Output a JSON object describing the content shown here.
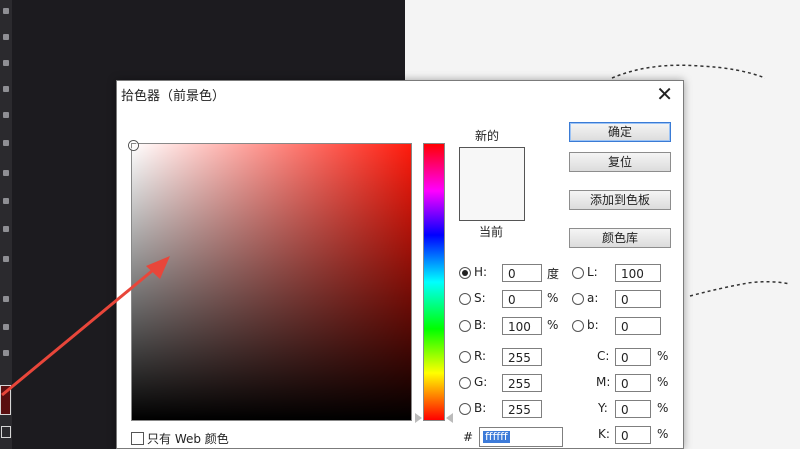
{
  "dialog": {
    "title": "拾色器（前景色）",
    "close_glyph": "✕"
  },
  "preview": {
    "new_label": "新的",
    "current_label": "当前",
    "new_color": "#f7f7f7"
  },
  "buttons": {
    "ok": "确定",
    "reset": "复位",
    "add_to_swatches": "添加到色板",
    "color_libraries": "颜色库"
  },
  "hsb": {
    "h": {
      "label": "H:",
      "value": "0",
      "unit": "度",
      "selected": true
    },
    "s": {
      "label": "S:",
      "value": "0",
      "unit": "%"
    },
    "b": {
      "label": "B:",
      "value": "100",
      "unit": "%"
    }
  },
  "rgb": {
    "r": {
      "label": "R:",
      "value": "255"
    },
    "g": {
      "label": "G:",
      "value": "255"
    },
    "b": {
      "label": "B:",
      "value": "255"
    }
  },
  "lab": {
    "l": {
      "label": "L:",
      "value": "100"
    },
    "a": {
      "label": "a:",
      "value": "0"
    },
    "b": {
      "label": "b:",
      "value": "0"
    }
  },
  "cmyk": {
    "c": {
      "label": "C:",
      "value": "0",
      "unit": "%"
    },
    "m": {
      "label": "M:",
      "value": "0",
      "unit": "%"
    },
    "y": {
      "label": "Y:",
      "value": "0",
      "unit": "%"
    },
    "k": {
      "label": "K:",
      "value": "0",
      "unit": "%"
    }
  },
  "hex": {
    "label": "#",
    "value": "ffffff"
  },
  "web_only": {
    "label": "只有 Web 颜色",
    "checked": false
  },
  "colors": {
    "annotation_arrow": "#e8463a",
    "foreground_swatch": "#5a0f10",
    "accent": "#3d7bd9"
  }
}
